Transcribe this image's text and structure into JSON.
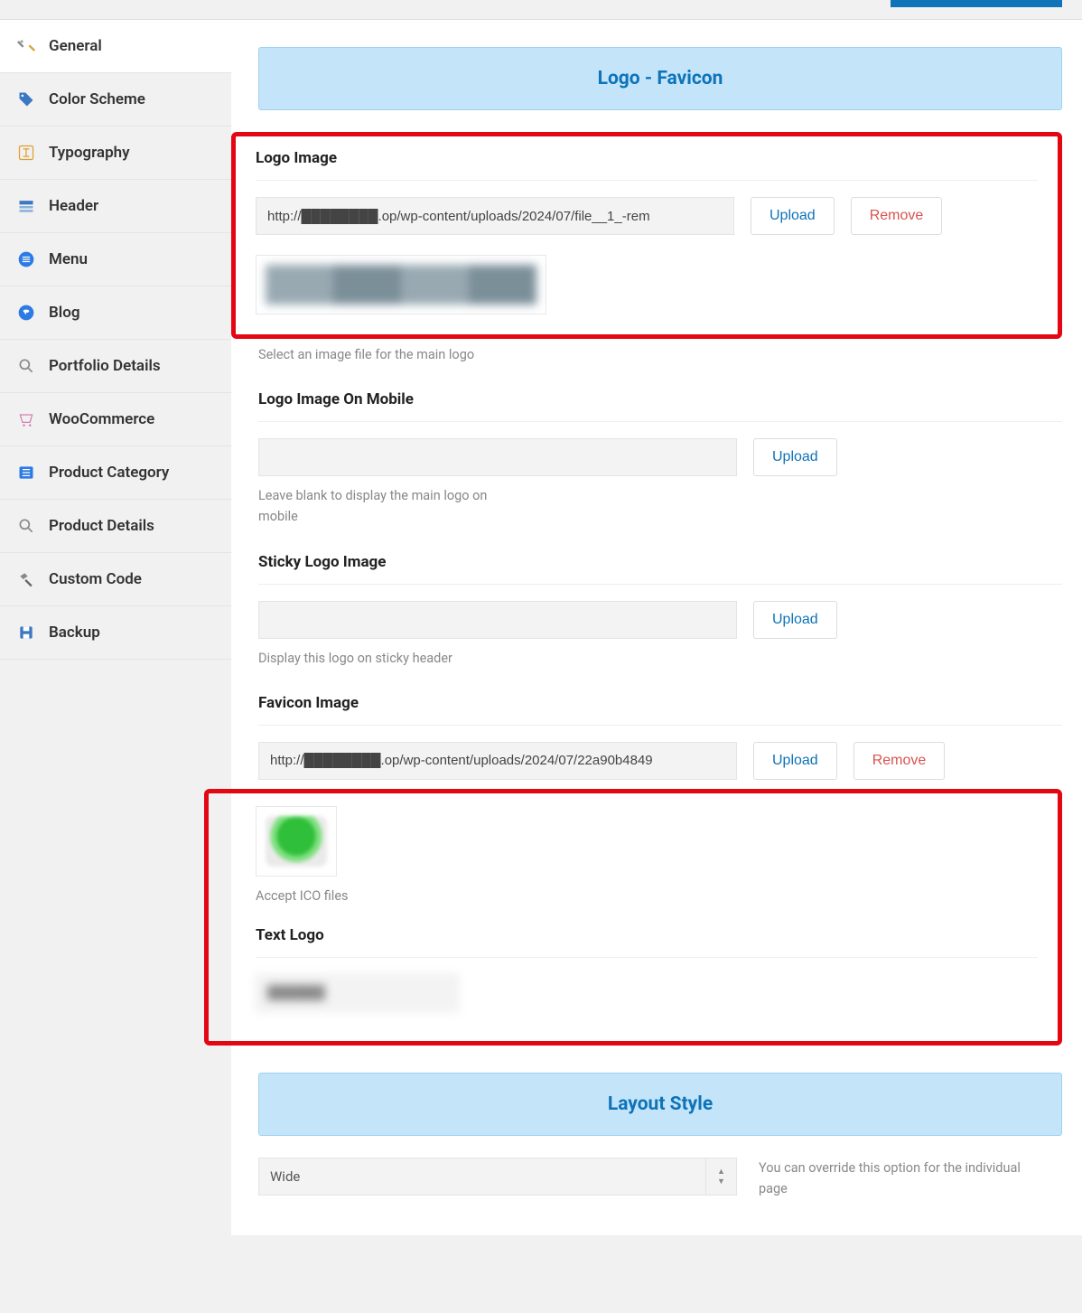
{
  "sidebar": {
    "items": [
      {
        "label": "General"
      },
      {
        "label": "Color Scheme"
      },
      {
        "label": "Typography"
      },
      {
        "label": "Header"
      },
      {
        "label": "Menu"
      },
      {
        "label": "Blog"
      },
      {
        "label": "Portfolio Details"
      },
      {
        "label": "WooCommerce"
      },
      {
        "label": "Product Category"
      },
      {
        "label": "Product Details"
      },
      {
        "label": "Custom Code"
      },
      {
        "label": "Backup"
      }
    ]
  },
  "section_logo_title": "Logo - Favicon",
  "section_layout_title": "Layout Style",
  "actions": {
    "upload": "Upload",
    "remove": "Remove"
  },
  "fields": {
    "logo_image": {
      "label": "Logo Image",
      "value": "http://████████.op/wp-content/uploads/2024/07/file__1_-rem",
      "help": "Select an image file for the main logo"
    },
    "logo_mobile": {
      "label": "Logo Image On Mobile",
      "value": "",
      "help": "Leave blank to display the main logo on mobile"
    },
    "sticky_logo": {
      "label": "Sticky Logo Image",
      "value": "",
      "help": "Display this logo on sticky header"
    },
    "favicon": {
      "label": "Favicon Image",
      "value": "http://████████.op/wp-content/uploads/2024/07/22a90b4849",
      "help": "Accept ICO files"
    },
    "text_logo": {
      "label": "Text Logo",
      "value": "██████"
    },
    "layout": {
      "value": "Wide",
      "help": "You can override this option for the individual page"
    }
  }
}
